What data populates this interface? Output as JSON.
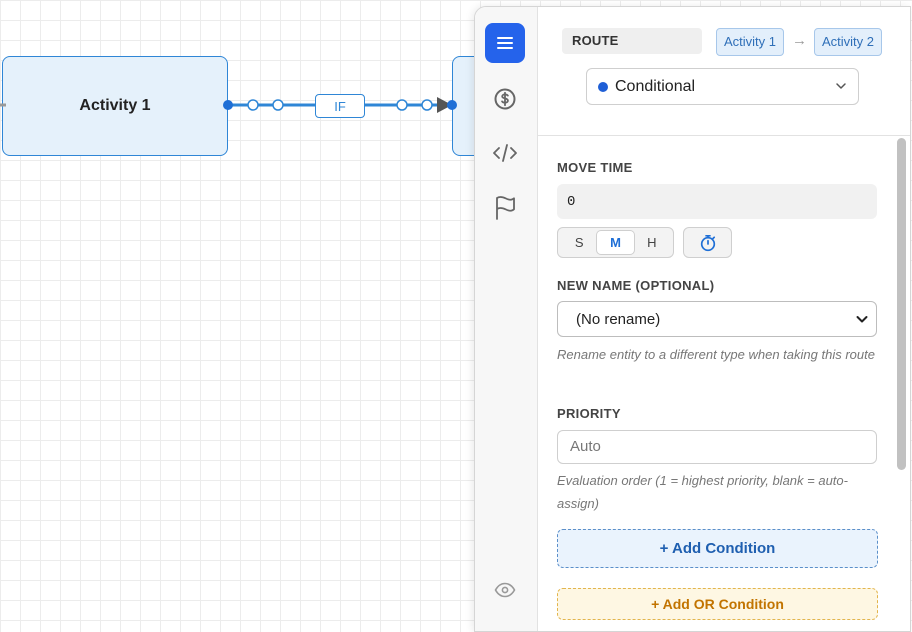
{
  "canvas": {
    "node_left_label": "Activity 1",
    "node_right_label": "",
    "edge_label": "IF"
  },
  "rail": {
    "icons": [
      "menu-icon",
      "dollar-icon",
      "code-icon",
      "flag-icon",
      "eye-icon"
    ]
  },
  "header": {
    "route_label": "ROUTE",
    "from_activity": "Activity 1",
    "arrow": "→",
    "to_activity": "Activity 2",
    "route_type": "Conditional"
  },
  "form": {
    "move_time_label": "MOVE TIME",
    "move_time_value": "0",
    "units": [
      "S",
      "M",
      "H"
    ],
    "selected_unit": "M",
    "new_name_label": "NEW NAME (OPTIONAL)",
    "new_name_value": "(No rename)",
    "new_name_help": "Rename entity to a different type when taking this route",
    "priority_label": "PRIORITY",
    "priority_placeholder": "Auto",
    "priority_help": "Evaluation order (1 = highest priority, blank = auto-assign)",
    "add_condition": "+ Add Condition",
    "add_or_condition": "+ Add OR Condition"
  },
  "colors": {
    "accent": "#2563eb",
    "node_border": "#2f86d6",
    "node_fill": "#e5f1fb",
    "or_accent": "#c27400"
  }
}
